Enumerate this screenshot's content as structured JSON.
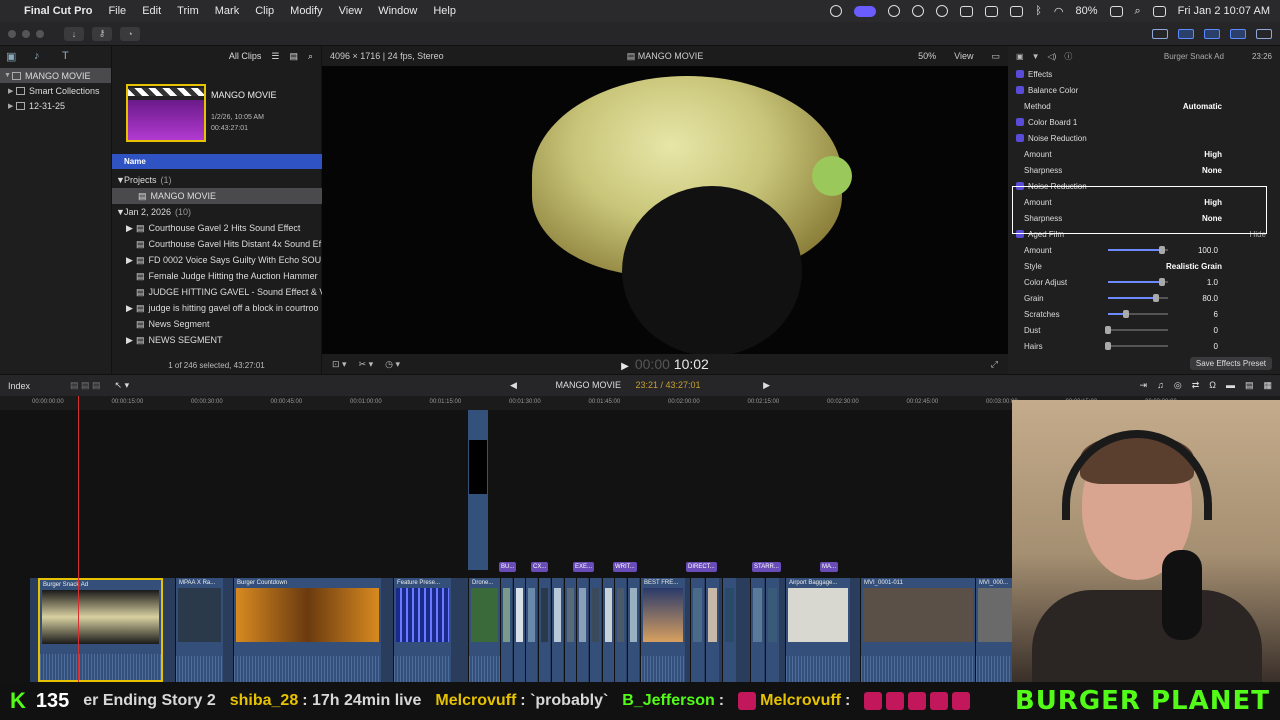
{
  "menubar": {
    "app_name": "Final Cut Pro",
    "items": [
      "File",
      "Edit",
      "Trim",
      "Mark",
      "Clip",
      "Modify",
      "View",
      "Window",
      "Help"
    ],
    "battery": "80%",
    "datetime": "Fri Jan 2  10:07 AM"
  },
  "library": {
    "items": [
      {
        "label": "MANGO MOVIE",
        "selected": true
      },
      {
        "label": "Smart Collections",
        "selected": false
      },
      {
        "label": "12-31-25",
        "selected": false
      }
    ]
  },
  "browser": {
    "filter_label": "All Clips",
    "project_title": "MANGO MOVIE",
    "project_date": "1/2/26, 10:05 AM",
    "project_duration": "00:43:27:01",
    "column_header": "Name",
    "projects_group": "Projects",
    "projects_count": "(1)",
    "project_row": "MANGO MOVIE",
    "date_group": "Jan 2, 2026",
    "date_count": "(10)",
    "clips": [
      "Courthouse Gavel 2 Hits Sound Effect",
      "Courthouse Gavel Hits Distant 4x Sound Ef",
      "FD 0002   Voice Says Guilty With Echo SOU",
      "Female Judge Hitting the Auction Hammer",
      "JUDGE HITTING GAVEL - Sound Effect & V",
      "judge is hitting gavel off a block in courtroo",
      "News Segment",
      "NEWS SEGMENT"
    ],
    "footer": "1 of 246 selected, 43:27:01"
  },
  "viewer": {
    "format": "4096 × 1716 | 24 fps, Stereo",
    "title": "MANGO MOVIE",
    "zoom": "50%",
    "view_menu": "View",
    "timecode_dim": "00:00",
    "timecode": "10:02"
  },
  "inspector": {
    "clip_name": "Burger Snack Ad",
    "duration": "23:26",
    "effects_label": "Effects",
    "rows": [
      {
        "label": "Balance Color",
        "type": "section"
      },
      {
        "label": "Method",
        "value": "Automatic",
        "type": "param"
      },
      {
        "label": "Color Board 1",
        "type": "section"
      },
      {
        "label": "Noise Reduction",
        "type": "section"
      },
      {
        "label": "Amount",
        "value": "High",
        "type": "param"
      },
      {
        "label": "Sharpness",
        "value": "None",
        "type": "param"
      },
      {
        "label": "Noise Reduction",
        "type": "section"
      },
      {
        "label": "Amount",
        "value": "High",
        "type": "param"
      },
      {
        "label": "Sharpness",
        "value": "None",
        "type": "param"
      },
      {
        "label": "Aged Film",
        "type": "section",
        "extra": "Hide"
      },
      {
        "label": "Amount",
        "value": "100.0",
        "type": "slider",
        "level": 0.9
      },
      {
        "label": "Style",
        "value": "Realistic Grain",
        "type": "param"
      },
      {
        "label": "Color Adjust",
        "value": "1.0",
        "type": "slider",
        "level": 0.9
      },
      {
        "label": "Grain",
        "value": "80.0",
        "type": "slider",
        "level": 0.8
      },
      {
        "label": "Scratches",
        "value": "6",
        "type": "slider",
        "level": 0.3
      },
      {
        "label": "Dust",
        "value": "0",
        "type": "slider",
        "level": 0.0
      },
      {
        "label": "Hairs",
        "value": "0",
        "type": "slider",
        "level": 0.0
      }
    ],
    "save_preset": "Save Effects Preset"
  },
  "timeline": {
    "index_label": "Index",
    "project_name": "MANGO MOVIE",
    "timecode": "23:21 / 43:27:01",
    "ruler": [
      "00:00:00:00",
      "00:00:15:00",
      "00:00:30:00",
      "00:00:45:00",
      "00:01:00:00",
      "00:01:15:00",
      "00:01:30:00",
      "00:01:45:00",
      "00:02:00:00",
      "00:02:15:00",
      "00:02:30:00",
      "00:02:45:00",
      "00:03:00:00",
      "00:03:15:00",
      "00:03:30:00"
    ],
    "titles": [
      "BU...",
      "CX...",
      "EXE...",
      "WRIT...",
      "DIRECT...",
      "STARR...",
      "MA..."
    ],
    "clips": [
      "Burger Snack Ad",
      "MPAA X Ra...",
      "Burger Countdown",
      "Feature Prese...",
      "Drone...",
      "BEST FRE...",
      "Airport Baggage...",
      "MVI_0001-011",
      "MVI_000..."
    ],
    "scale": [
      "6",
      "0",
      "-6",
      "-12"
    ]
  },
  "ticker": {
    "k": "K",
    "count": "135",
    "segments": [
      {
        "text": "er Ending Story 2",
        "color": "white"
      },
      {
        "text": "shiba_28",
        "color": "yellow"
      },
      {
        "text": ": 17h 24min live",
        "color": "white"
      },
      {
        "text": "Melcrovuff",
        "color": "yellow"
      },
      {
        "text": ": `probably`",
        "color": "white"
      },
      {
        "text": "B_Jefferson",
        "color": "green"
      },
      {
        "text": ":",
        "color": "white"
      },
      {
        "text": "Melcrovuff",
        "color": "yellow"
      },
      {
        "text": ":",
        "color": "white"
      }
    ],
    "brand": "BURGER PLANET"
  }
}
